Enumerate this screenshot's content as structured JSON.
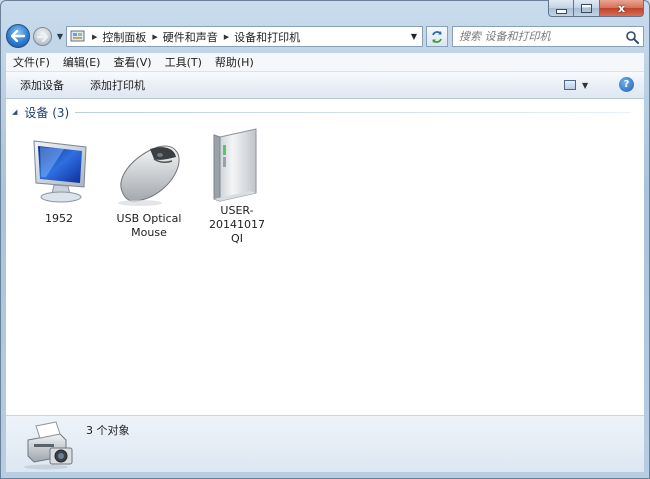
{
  "window": {
    "caption_buttons": {
      "minimize_icon": "minimize-icon",
      "maximize_icon": "maximize-icon",
      "close_label": "x"
    }
  },
  "nav": {
    "back_icon": "back-arrow-icon",
    "forward_icon": "forward-arrow-icon",
    "breadcrumbs": [
      "控制面板",
      "硬件和声音",
      "设备和打印机"
    ],
    "search_placeholder": "搜索 设备和打印机"
  },
  "menubar": {
    "items": [
      "文件(F)",
      "编辑(E)",
      "查看(V)",
      "工具(T)",
      "帮助(H)"
    ]
  },
  "toolbar": {
    "add_device": "添加设备",
    "add_printer": "添加打印机"
  },
  "group": {
    "title": "设备 (3)"
  },
  "devices": [
    {
      "name": "1952",
      "icon": "monitor-icon"
    },
    {
      "name": "USB Optical\nMouse",
      "icon": "mouse-icon"
    },
    {
      "name": "USER-20141017\nQI",
      "icon": "computer-tower-icon"
    }
  ],
  "details": {
    "count_text": "3 个对象",
    "icon": "printer-camera-icon"
  },
  "colors": {
    "frame": "#b7cde2",
    "group_title": "#1e3f6e",
    "accent_blue": "#2f7fd5"
  }
}
